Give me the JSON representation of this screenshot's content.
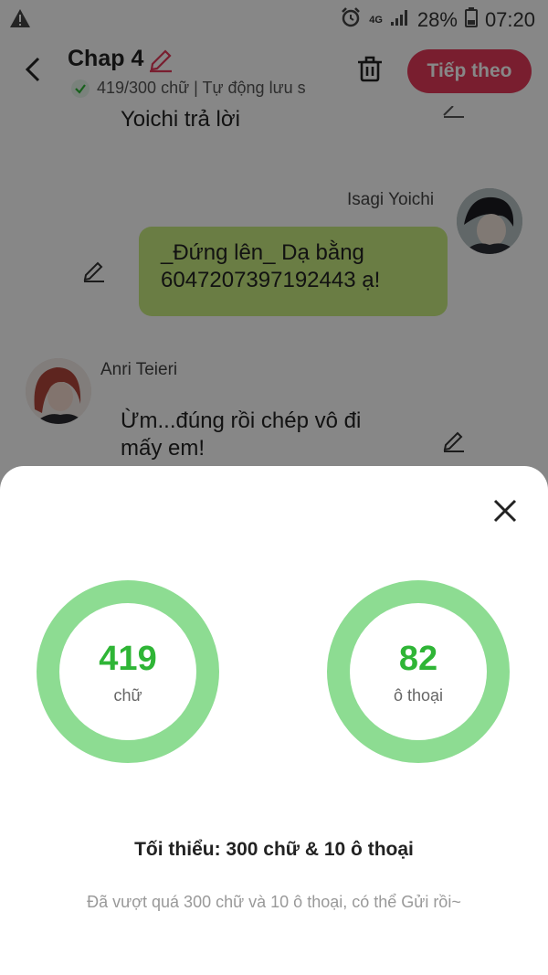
{
  "status_bar": {
    "network": "4G",
    "battery": "28%",
    "time": "07:20"
  },
  "header": {
    "title": "Chap 4",
    "subtitle": "419/300 chữ | Tự động lưu s",
    "next_label": "Tiếp theo"
  },
  "chat": {
    "messages": [
      {
        "text": "Yoichi trả lời"
      },
      {
        "sender": "Isagi Yoichi",
        "text": "_Đứng lên_ Dạ bằng 6047207397192443 ạ!"
      },
      {
        "sender": "Anri Teieri",
        "text": "Ừm...đúng rồi chép vô đi mấy em!"
      }
    ]
  },
  "sheet": {
    "word_count": "419",
    "word_label": "chữ",
    "dialogue_count": "82",
    "dialogue_label": "ô thoại",
    "minimum": "Tối thiểu: 300 chữ & 10 ô thoại",
    "note": "Đã vượt quá 300 chữ và 10 ô thoại, có thể Gửi rồi~"
  },
  "colors": {
    "accent": "#e43a5a",
    "ring": "#8ddc92",
    "count": "#2fb536",
    "bubble_self": "#c8ec80"
  }
}
